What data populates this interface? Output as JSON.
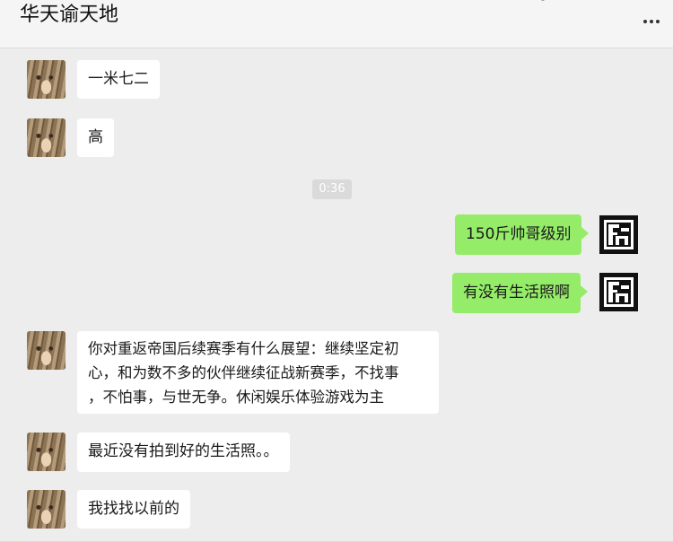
{
  "header": {
    "title": "华天谕天地",
    "more_icon": "more-horizontal-icon"
  },
  "messages": [
    {
      "side": "left",
      "text": "一米七二"
    },
    {
      "side": "left",
      "text": "高"
    },
    {
      "type": "time",
      "text": "0:36"
    },
    {
      "side": "right",
      "text": "150斤帅哥级别"
    },
    {
      "side": "right",
      "text": "有没有生活照啊"
    },
    {
      "side": "left",
      "lines": [
        "你对重返帝国后续赛季有什么展望：继续坚定初",
        "心，和为数不多的伙伴继续征战新赛季，不找事",
        "，不怕事，与世无争。休闲娱乐体验游戏为主"
      ]
    },
    {
      "side": "left",
      "text": "最近没有拍到好的生活照。。"
    },
    {
      "side": "left",
      "text": "我找找以前的"
    }
  ],
  "colors": {
    "background": "#ededed",
    "outgoing_bubble": "#95ec69",
    "incoming_bubble": "#ffffff"
  }
}
